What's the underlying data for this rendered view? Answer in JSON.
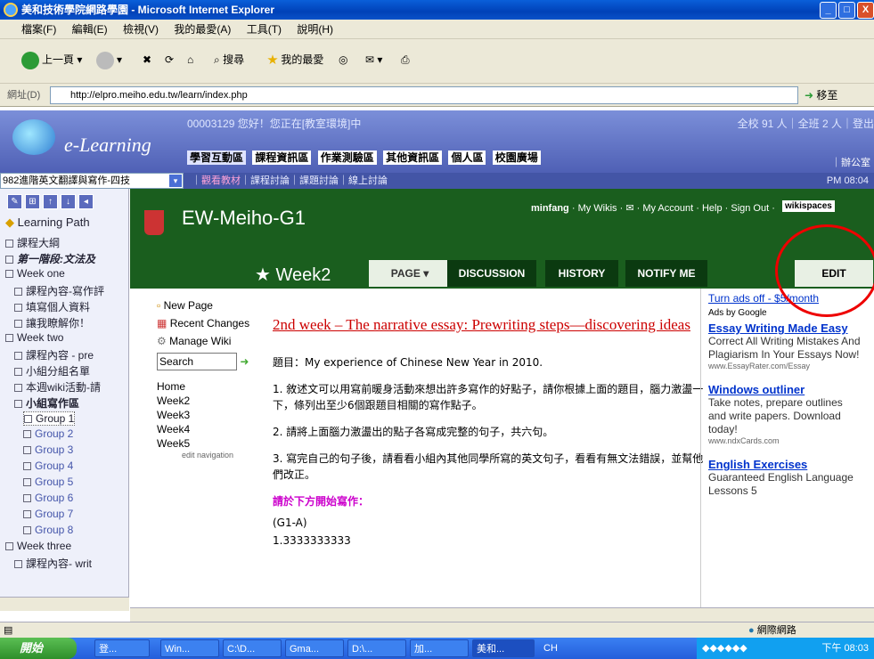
{
  "window": {
    "title": "美和技術學院網路學園 - Microsoft Internet Explorer",
    "min": "_",
    "max": "□",
    "close": "X"
  },
  "menu": [
    "檔案(F)",
    "編輯(E)",
    "檢視(V)",
    "我的最愛(A)",
    "工具(T)",
    "說明(H)"
  ],
  "toolbar": {
    "back": "上一頁",
    "search": "搜尋",
    "favorites": "我的最愛"
  },
  "address": {
    "label": "網址(D)",
    "url": "http://elpro.meiho.edu.tw/learn/index.php",
    "go": "移至"
  },
  "elearning": {
    "logo": "e-Learning",
    "welcome": "00003129 您好！您正在[教室環境]中",
    "stats": "全校 91 人｜全班 2 人｜登出",
    "tabs": [
      "學習互動區",
      "課程資訊區",
      "作業測驗區",
      "其他資訊區",
      "個人區",
      "校園廣場"
    ],
    "right_link": "｜辦公室"
  },
  "subbar": {
    "course": "982進階英文翻譯與寫作-四技",
    "links_active": "觀看教材",
    "links": "｜課程討論｜課題討論｜線上討論",
    "time": "PM 08:04"
  },
  "tree": {
    "tools": [
      "✎",
      "⊞",
      "↑",
      "↓",
      "◂"
    ],
    "title": "Learning Path",
    "items": [
      "課程大綱",
      "第一階段:文法及",
      "Week one",
      "課程內容-寫作評",
      "填寫個人資料",
      "讓我瞭解你！",
      "Week two",
      "課程內容 - pre",
      "小組分組名單",
      "本週wiki活動-請",
      "小組寫作區",
      "Group 1",
      "Group 2",
      "Group 3",
      "Group 4",
      "Group 5",
      "Group 6",
      "Group 7",
      "Group 8",
      "Week three",
      "課程內容- writ"
    ]
  },
  "wiki": {
    "title": "EW-Meiho-G1",
    "user": "minfang",
    "links": "· My Wikis · ✉ · My Account · Help · Sign Out ·",
    "brand": "wikispaces",
    "week": "★ Week2",
    "tabs": [
      "PAGE ▾",
      "DISCUSSION",
      "HISTORY",
      "NOTIFY ME"
    ],
    "edit": "EDIT",
    "nav": {
      "new_page": "New Page",
      "recent": "Recent Changes",
      "manage": "Manage Wiki",
      "search": "Search",
      "pages": [
        "Home",
        "Week2",
        "Week3",
        "Week4",
        "Week5"
      ],
      "edit_nav": "edit navigation"
    },
    "heading": "2nd week – The narrative essay: Prewriting steps—discovering ideas",
    "topic": "題目：My experience of Chinese New Year in 2010.",
    "p1": "1. 敘述文可以用寫前暖身活動來想出許多寫作的好點子，請你根據上面的題目，腦力激盪一下，條列出至少6個跟題目相關的寫作點子。",
    "p2": "2. 請將上面腦力激盪出的點子各寫成完整的句子，共六句。",
    "p3": "3. 寫完自己的句子後，請看看小組內其他同學所寫的英文句子，看看有無文法錯誤，並幫他們改正。",
    "start": "請於下方開始寫作：",
    "g1": "(G1-A)",
    "line1": "1.3333333333"
  },
  "ads": {
    "turnoff": "Turn ads off - $5/month",
    "by": "Ads by Google",
    "items": [
      {
        "t": "Essay Writing Made Easy",
        "b": "Correct All Writing Mistakes And Plagiarism In Your Essays Now!",
        "u": "www.EssayRater.com/Essay"
      },
      {
        "t": "Windows outliner",
        "b": "Take notes, prepare outlines and write papers. Download today!",
        "u": "www.ndxCards.com"
      },
      {
        "t": "English Exercises",
        "b": "Guaranteed English Language Lessons 5",
        "u": ""
      }
    ]
  },
  "status": {
    "zone": "網際網路"
  },
  "taskbar": {
    "start": "開始",
    "items": [
      "登...",
      "Win...",
      "C:\\D...",
      "Gma...",
      "D:\\...",
      "加...",
      "美和...",
      "CH"
    ],
    "clock": "下午 08:03"
  }
}
